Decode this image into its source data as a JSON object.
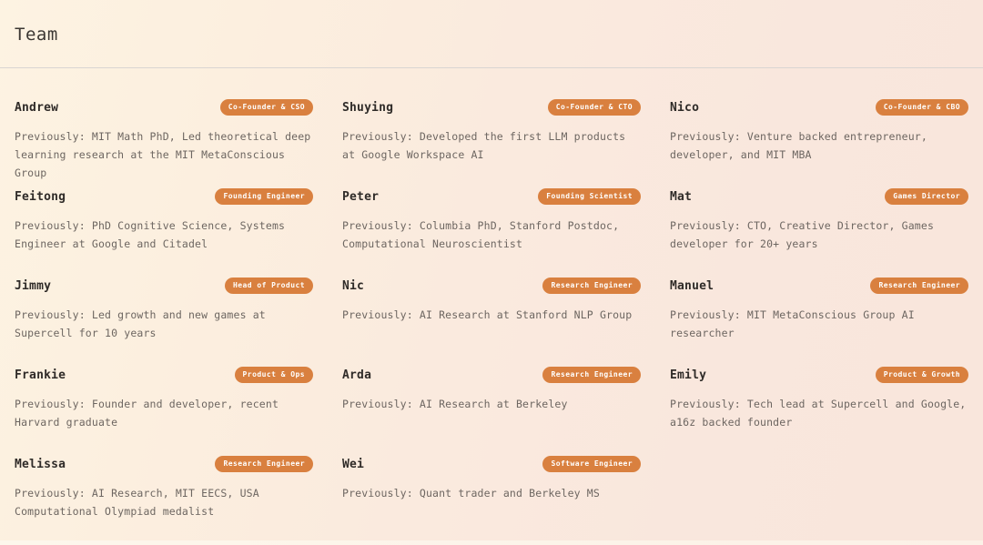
{
  "header": {
    "title": "Team"
  },
  "styles": {
    "badge_bg": "#d9803f",
    "badge_text": "#ffffff",
    "name_text": "#2f2b28",
    "bio_text": "#6d6661",
    "divider": "#d9d5d2",
    "bg_from": "#fdf3e2",
    "bg_to": "#f9e6dc"
  },
  "team": {
    "members": [
      {
        "name": "Andrew",
        "role": "Co-Founder & CSO",
        "bio": "Previously: MIT Math PhD, Led theoretical deep learning research at the MIT MetaConscious Group"
      },
      {
        "name": "Shuying",
        "role": "Co-Founder & CTO",
        "bio": "Previously: Developed the first LLM products at Google Workspace AI"
      },
      {
        "name": "Nico",
        "role": "Co-Founder & CBO",
        "bio": "Previously: Venture backed entrepreneur, developer, and MIT MBA"
      },
      {
        "name": "Feitong",
        "role": "Founding Engineer",
        "bio": "Previously: PhD Cognitive Science, Systems Engineer at Google and Citadel"
      },
      {
        "name": "Peter",
        "role": "Founding Scientist",
        "bio": "Previously: Columbia PhD, Stanford Postdoc, Computational Neuroscientist"
      },
      {
        "name": "Mat",
        "role": "Games Director",
        "bio": "Previously: CTO, Creative Director, Games developer for 20+ years"
      },
      {
        "name": "Jimmy",
        "role": "Head of Product",
        "bio": "Previously: Led growth and new games at Supercell for 10 years"
      },
      {
        "name": "Nic",
        "role": "Research Engineer",
        "bio": "Previously: AI Research at Stanford NLP Group"
      },
      {
        "name": "Manuel",
        "role": "Research Engineer",
        "bio": "Previously: MIT MetaConscious Group AI researcher"
      },
      {
        "name": "Frankie",
        "role": "Product & Ops",
        "bio": "Previously: Founder and developer, recent Harvard graduate"
      },
      {
        "name": "Arda",
        "role": "Research Engineer",
        "bio": "Previously: AI Research at Berkeley"
      },
      {
        "name": "Emily",
        "role": "Product & Growth",
        "bio": "Previously: Tech lead at Supercell and Google, a16z backed founder"
      },
      {
        "name": "Melissa",
        "role": "Research Engineer",
        "bio": "Previously: AI Research, MIT EECS, USA Computational Olympiad medalist"
      },
      {
        "name": "Wei",
        "role": "Software Engineer",
        "bio": "Previously: Quant trader and Berkeley MS"
      }
    ]
  }
}
